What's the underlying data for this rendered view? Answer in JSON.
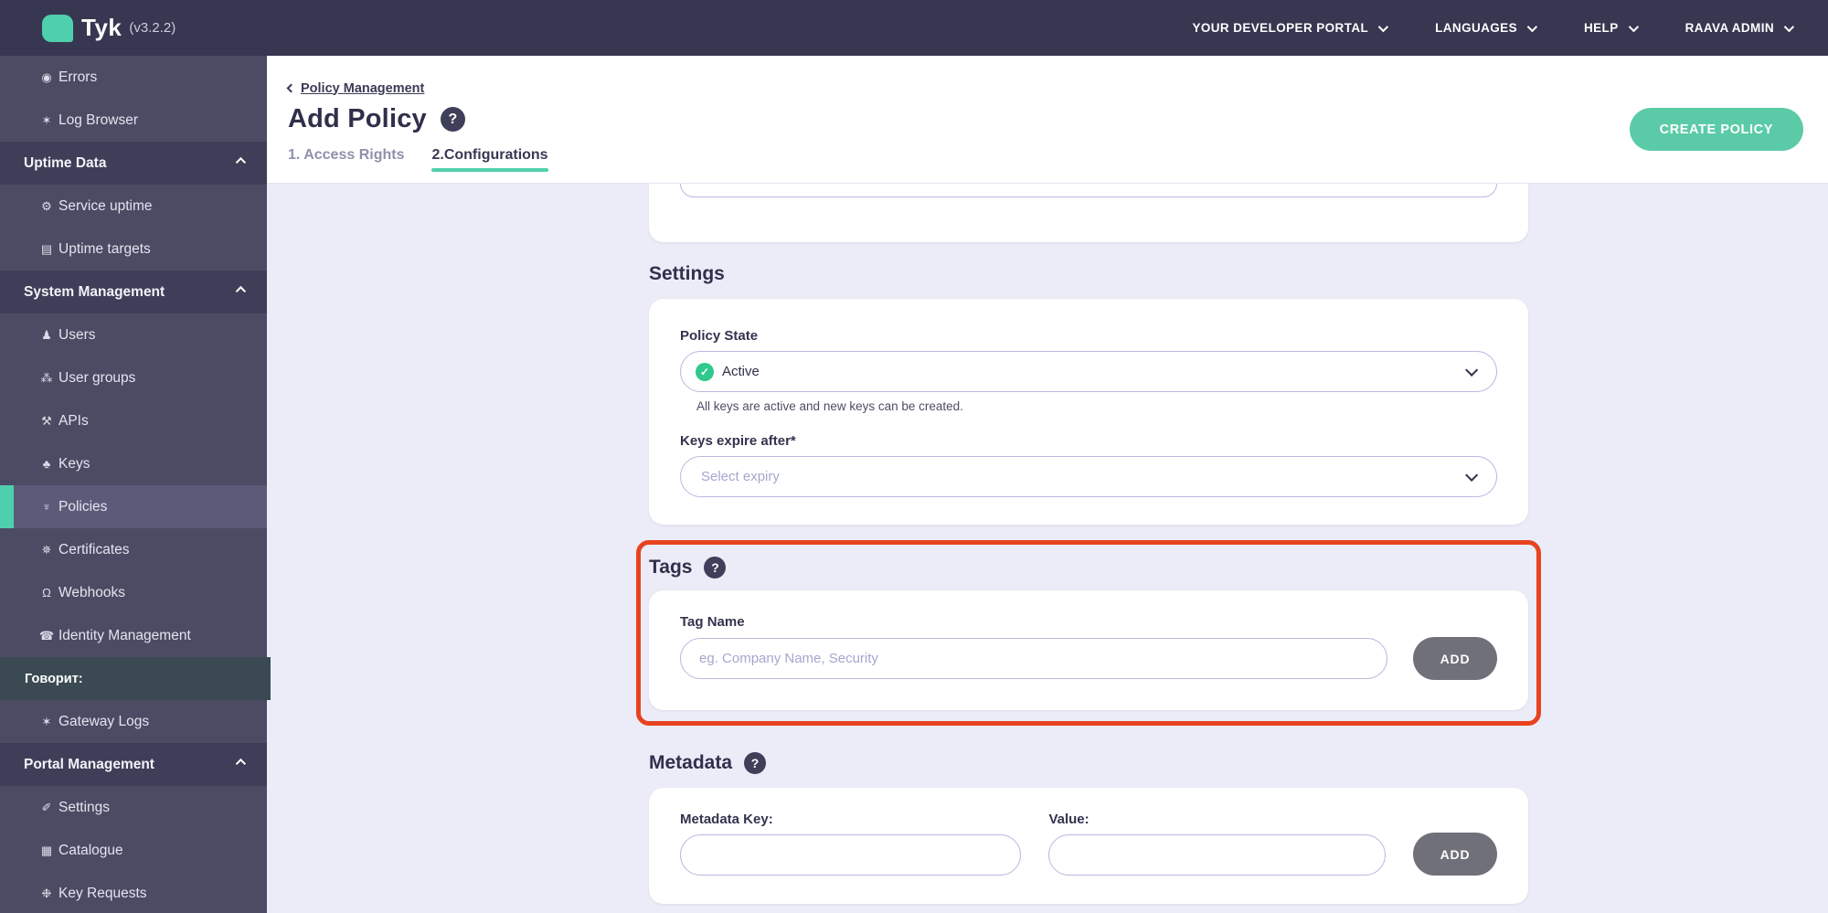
{
  "topbar": {
    "product": "Tyk",
    "version": "(v3.2.2)",
    "menus": [
      {
        "label": "YOUR DEVELOPER PORTAL"
      },
      {
        "label": "LANGUAGES"
      },
      {
        "label": "HELP"
      },
      {
        "label": "RAAVA ADMIN"
      }
    ]
  },
  "sidebar": {
    "items": [
      {
        "type": "link",
        "icon": "bomb-icon",
        "label": "Errors"
      },
      {
        "type": "link",
        "icon": "bug-icon",
        "label": "Log Browser"
      },
      {
        "type": "section",
        "label": "Uptime Data"
      },
      {
        "type": "link",
        "icon": "gauge-icon",
        "label": "Service uptime"
      },
      {
        "type": "link",
        "icon": "list-icon",
        "label": "Uptime targets"
      },
      {
        "type": "section",
        "label": "System Management"
      },
      {
        "type": "link",
        "icon": "user-icon",
        "label": "Users"
      },
      {
        "type": "link",
        "icon": "user-group-icon",
        "label": "User groups"
      },
      {
        "type": "link",
        "icon": "gears-icon",
        "label": "APIs"
      },
      {
        "type": "link",
        "icon": "sitemap-icon",
        "label": "Keys"
      },
      {
        "type": "link",
        "icon": "plug-icon",
        "label": "Policies",
        "active": true
      },
      {
        "type": "link",
        "icon": "certificate-icon",
        "label": "Certificates"
      },
      {
        "type": "link",
        "icon": "bell-icon",
        "label": "Webhooks"
      },
      {
        "type": "link",
        "icon": "phone-icon",
        "label": "Identity Management"
      },
      {
        "type": "overlay",
        "label": "Говорит:"
      },
      {
        "type": "link",
        "icon": "bug-icon",
        "label": "Gateway Logs"
      },
      {
        "type": "section",
        "label": "Portal Management"
      },
      {
        "type": "link",
        "icon": "wrench-icon",
        "label": "Settings"
      },
      {
        "type": "link",
        "icon": "catalogue-icon",
        "label": "Catalogue"
      },
      {
        "type": "link",
        "icon": "paw-icon",
        "label": "Key Requests"
      }
    ]
  },
  "page": {
    "breadcrumb": "Policy Management",
    "title": "Add Policy",
    "tabs": [
      {
        "label": "1. Access Rights",
        "active": false
      },
      {
        "label": "2.Configurations",
        "active": true
      }
    ],
    "create_button": "CREATE POLICY"
  },
  "settings": {
    "heading": "Settings",
    "policy_state_label": "Policy State",
    "policy_state_value": "Active",
    "policy_state_helper": "All keys are active and new keys can be created.",
    "keys_expire_label": "Keys expire after*",
    "keys_expire_placeholder": "Select expiry"
  },
  "tags": {
    "heading": "Tags",
    "field_label": "Tag Name",
    "placeholder": "eg. Company Name, Security",
    "input_value": "",
    "add_button": "ADD"
  },
  "metadata": {
    "heading": "Metadata",
    "key_label": "Metadata Key:",
    "value_label": "Value:",
    "key_value": "",
    "value_value": "",
    "add_button": "ADD"
  },
  "icons": {
    "bomb-icon": "◉",
    "bug-icon": "✶",
    "gauge-icon": "⚙",
    "list-icon": "▤",
    "user-icon": "♟",
    "user-group-icon": "⁂",
    "gears-icon": "⚒",
    "sitemap-icon": "♣",
    "plug-icon": "♆",
    "certificate-icon": "✵",
    "bell-icon": "Ω",
    "phone-icon": "☎",
    "wrench-icon": "✐",
    "catalogue-icon": "▦",
    "paw-icon": "❉",
    "question-mark": "?",
    "check-mark": "✓"
  },
  "colors": {
    "accent_teal": "#4fd0ac",
    "button_teal": "#5bcba7",
    "highlight_red": "#e8431f",
    "active_green": "#2fc98e",
    "topbar_bg": "#373751",
    "sidebar_bg": "#4b4b64",
    "content_bg": "#ebecf7"
  }
}
